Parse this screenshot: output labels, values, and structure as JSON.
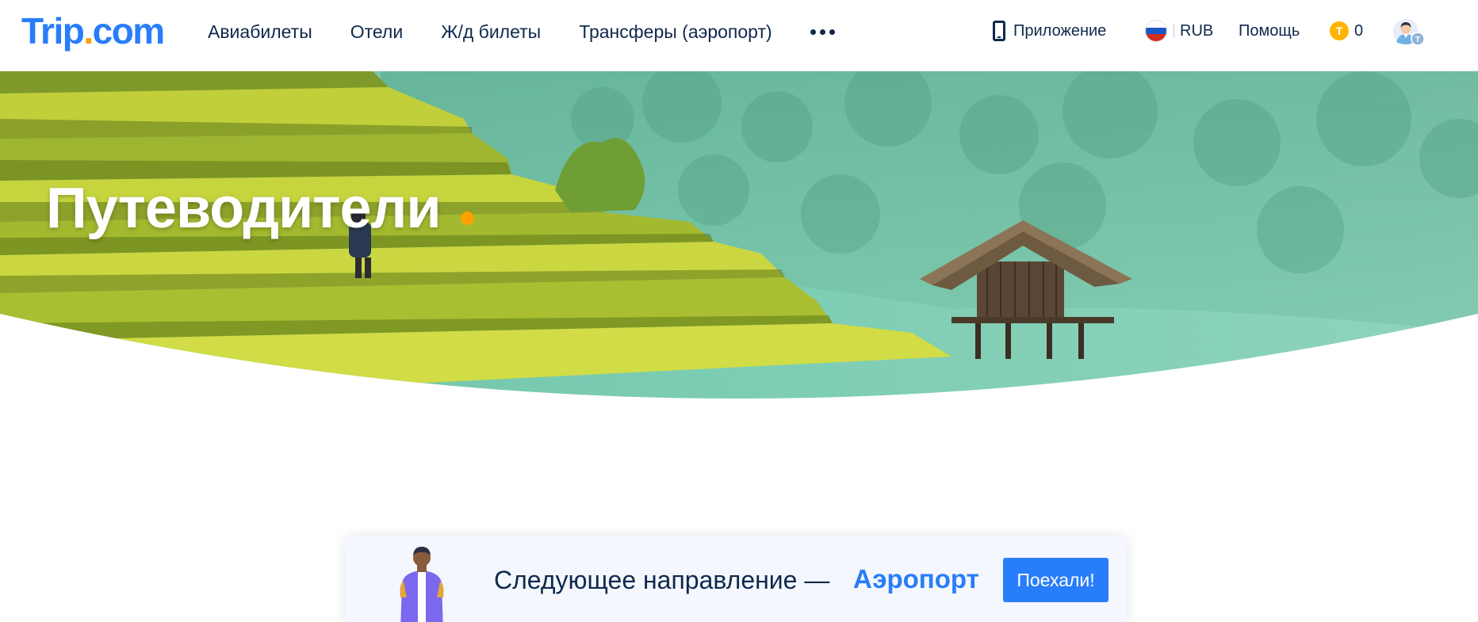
{
  "header": {
    "logo": {
      "text_main": "Trip",
      "text_dot": ".",
      "text_suffix": "com"
    },
    "nav": [
      {
        "label": "Авиабилеты"
      },
      {
        "label": "Отели"
      },
      {
        "label": "Ж/д билеты"
      },
      {
        "label": "Трансферы (аэропорт)"
      }
    ],
    "more_icon": "more-dots-icon",
    "app_label": "Приложение",
    "currency": "RUB",
    "help_label": "Помощь",
    "coins_symbol": "T",
    "coins_count": "0",
    "colors": {
      "brand": "#287dfa",
      "accent": "#ffa000",
      "text": "#0f294d"
    }
  },
  "hero": {
    "title": "Путеводители",
    "image": "rice-terraces-with-hut-illustration"
  },
  "promo": {
    "text": "Следующее направление —",
    "destination": "Аэропорт",
    "button_label": "Поехали!"
  }
}
